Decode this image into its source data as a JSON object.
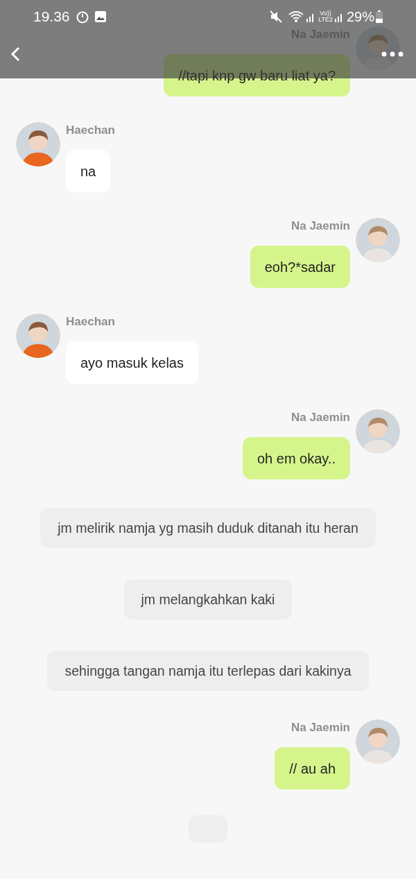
{
  "status_bar": {
    "time": "19.36",
    "network_label": "Vo))",
    "network_sub": "LTE2",
    "battery": "29%"
  },
  "messages": [
    {
      "kind": "sent",
      "name": "Na Jaemin",
      "text": "//tapi knp gw baru liat ya?"
    },
    {
      "kind": "received",
      "name": "Haechan",
      "text": "na"
    },
    {
      "kind": "sent",
      "name": "Na Jaemin",
      "text": "eoh?*sadar"
    },
    {
      "kind": "received",
      "name": "Haechan",
      "text": "ayo masuk kelas"
    },
    {
      "kind": "sent",
      "name": "Na Jaemin",
      "text": "oh em okay.."
    },
    {
      "kind": "narration",
      "text": "jm melirik namja yg masih duduk ditanah itu heran"
    },
    {
      "kind": "narration",
      "text": "jm melangkahkan kaki"
    },
    {
      "kind": "narration",
      "text": "sehingga tangan namja itu terlepas dari kakinya"
    },
    {
      "kind": "sent",
      "name": "Na Jaemin",
      "text": "// au ah"
    }
  ]
}
